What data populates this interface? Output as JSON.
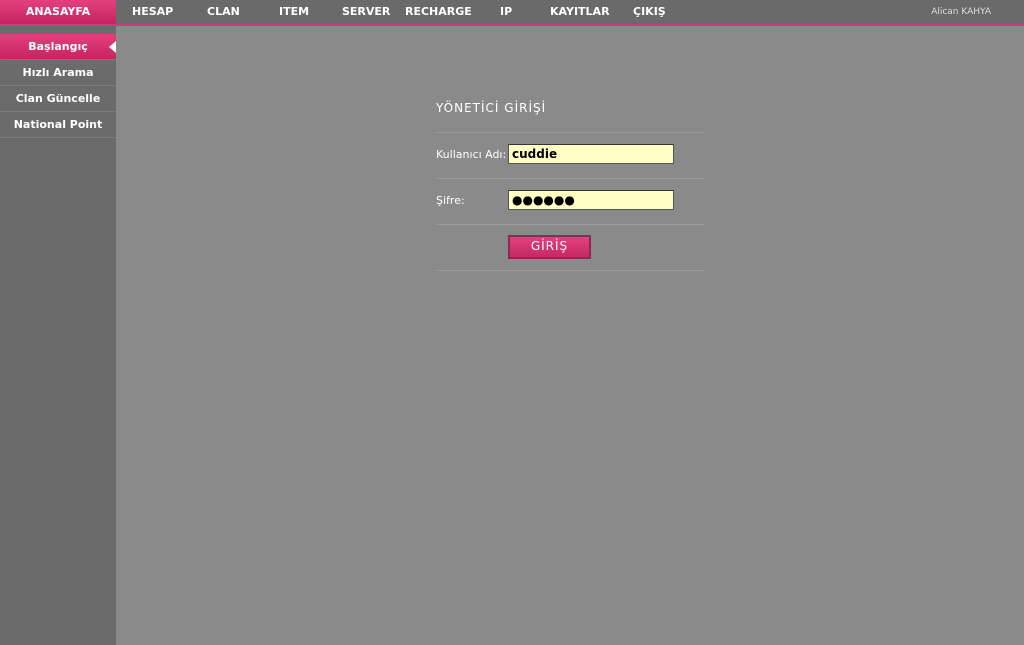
{
  "topnav": {
    "home": "ANASAYFA",
    "items": [
      "HESAP",
      "CLAN",
      "ITEM",
      "SERVER",
      "RECHARGE",
      "IP",
      "KAYITLAR",
      "ÇIKIŞ"
    ],
    "user": "Alican KAHYA"
  },
  "sidebar": {
    "items": [
      "Başlangıç",
      "Hızlı Arama",
      "Clan Güncelle",
      "National Point"
    ],
    "active_index": 0
  },
  "login": {
    "title": "YÖNETİCİ GİRİŞİ",
    "username_label": "Kullanıcı Adı:",
    "username_value": "cuddie",
    "password_label": "Şifre:",
    "password_value": "●●●●●●",
    "submit_label": "GİRİŞ"
  },
  "colors": {
    "accent": "#d4387a",
    "background": "#8a8a8a",
    "sidebar": "#6b6b6b",
    "input_bg": "#ffffc4"
  }
}
